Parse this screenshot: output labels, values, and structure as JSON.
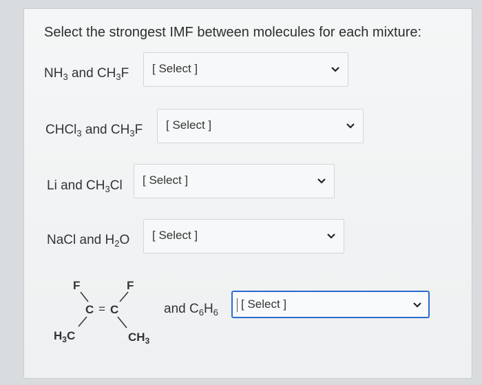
{
  "question": {
    "title": "Select the strongest IMF between molecules for each mixture:"
  },
  "rows": [
    {
      "label_a": "NH",
      "sub_a": "3",
      "mid": " and CH",
      "sub_b": "3",
      "tail": "F",
      "select_value": "[ Select ]"
    },
    {
      "label_a": "CHCl",
      "sub_a": "3",
      "mid": " and CH",
      "sub_b": "3",
      "tail": "F",
      "select_value": "[ Select ]"
    },
    {
      "label_a": "Li and CH",
      "sub_a": "3",
      "mid": "Cl",
      "select_value": "[ Select ]"
    },
    {
      "label_a": "NaCl and H",
      "sub_a": "2",
      "mid": "O",
      "select_value": "[ Select ]"
    }
  ],
  "molecule": {
    "atom_f1": "F",
    "atom_f2": "F",
    "atom_c1": "C",
    "double_bond": "=",
    "atom_c2": "C",
    "methyl_left": "H",
    "methyl_left_sub": "3",
    "methyl_left_tail": "C",
    "methyl_right": "CH",
    "methyl_right_sub": "3"
  },
  "last_row": {
    "label": "and C",
    "sub_a": "6",
    "mid": "H",
    "sub_b": "6",
    "select_value": "[ Select ]"
  },
  "icons": {
    "dropdown": "chevron-down-icon"
  },
  "colors": {
    "focus_border": "#2a6ad0"
  }
}
